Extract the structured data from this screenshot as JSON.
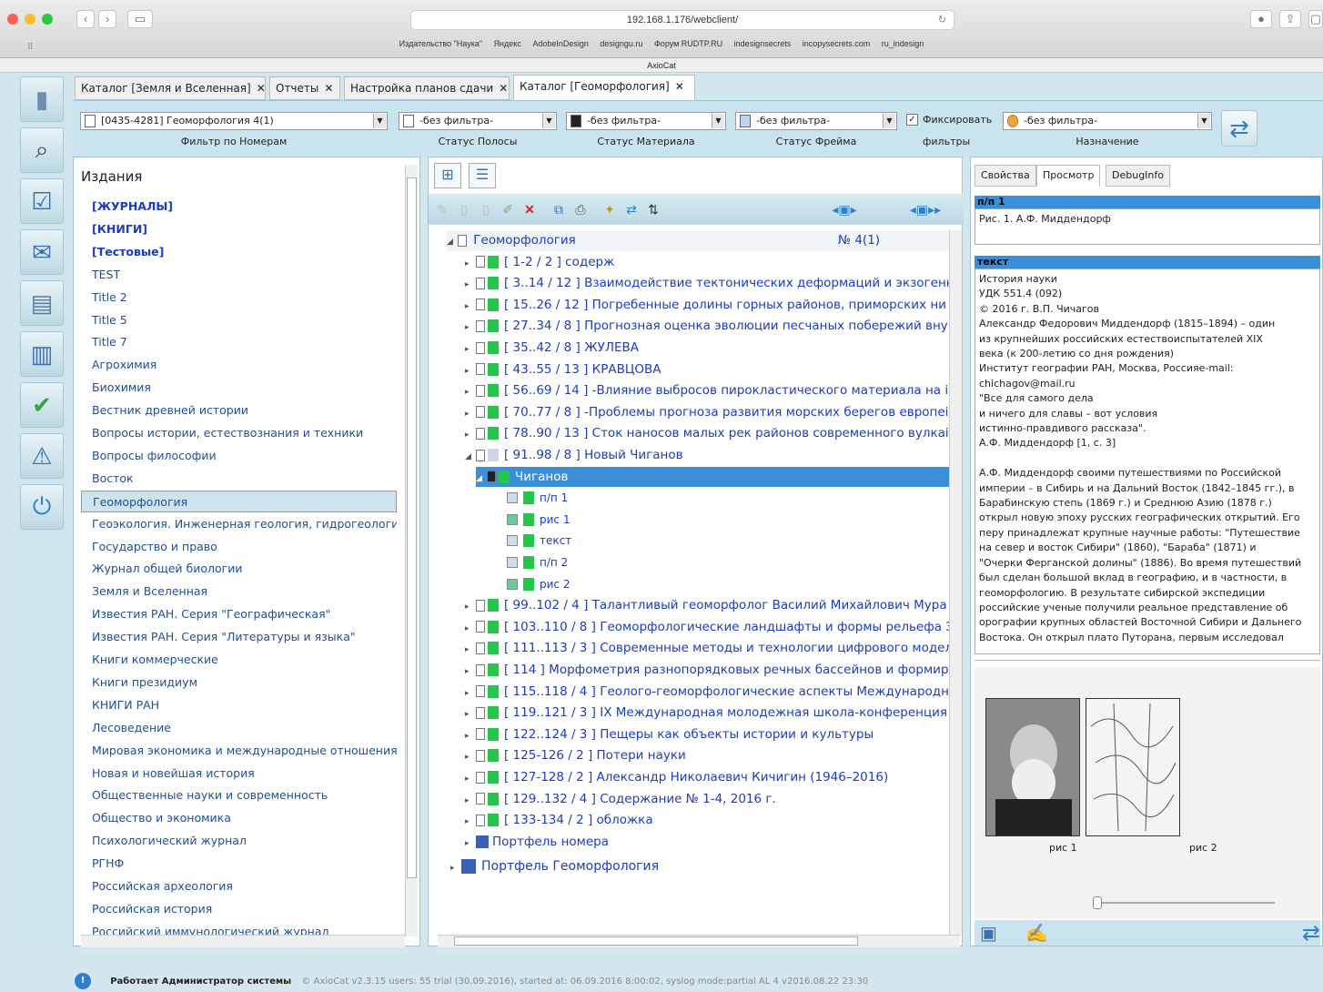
{
  "browser": {
    "url": "192.168.1.176/webclient/",
    "bookmarks": [
      "Издательство \"Наука\"",
      "Яндекс",
      "AdobeInDesign",
      "designgu.ru",
      "Форум RUDTP.RU",
      "indesignsecrets",
      "incopysecrets.com",
      "ru_indesign"
    ],
    "title": "AxioCat"
  },
  "tabs": [
    {
      "label": "Каталог [Земля и Вселенная]"
    },
    {
      "label": "Отчеты"
    },
    {
      "label": "Настройка планов сдачи"
    },
    {
      "label": "Каталог [Геоморфология]"
    }
  ],
  "filters": {
    "number_value": "[0435-4281] Геоморфология 4(1)",
    "number_label": "Фильтр по Номерам",
    "page_status_value": "-без фильтра-",
    "page_status_label": "Статус Полосы",
    "material_status_value": "-без фильтра-",
    "material_status_label": "Статус Материала",
    "frame_status_value": "-без фильтра-",
    "frame_status_label": "Статус Фрейма",
    "fix_label_1": "Фиксировать",
    "fix_label_2": "фильтры",
    "assign_value": "-без фильтра-",
    "assign_label": "Назначение"
  },
  "publications": {
    "header": "Издания",
    "items": [
      {
        "label": "[ЖУРНАЛЫ]"
      },
      {
        "label": "[КНИГИ]"
      },
      {
        "label": "[Тестовые]"
      },
      {
        "label": "TEST"
      },
      {
        "label": "Title 2"
      },
      {
        "label": "Title 5"
      },
      {
        "label": "Title 7"
      },
      {
        "label": "Агрохимия"
      },
      {
        "label": "Биохимия"
      },
      {
        "label": "Вестник древней истории"
      },
      {
        "label": "Вопросы истории, естествознания и техники"
      },
      {
        "label": "Вопросы философии"
      },
      {
        "label": "Восток"
      },
      {
        "label": "Геоморфология"
      },
      {
        "label": "Геоэкология. Инженерная геология, гидрогеология"
      },
      {
        "label": "Государство и право"
      },
      {
        "label": "Журнал общей биологии"
      },
      {
        "label": "Земля и Вселенная"
      },
      {
        "label": "Известия РАН. Серия \"Географическая\""
      },
      {
        "label": "Известия РАН. Серия \"Литературы и языка\""
      },
      {
        "label": "Книги коммерческие"
      },
      {
        "label": "Книги президиум"
      },
      {
        "label": "КНИГИ РАН"
      },
      {
        "label": "Лесоведение"
      },
      {
        "label": "Мировая экономика и международные отношения"
      },
      {
        "label": "Новая и новейшая история"
      },
      {
        "label": "Общественные науки и современность"
      },
      {
        "label": "Общество и экономика"
      },
      {
        "label": "Психологический журнал"
      },
      {
        "label": "РГНФ"
      },
      {
        "label": "Российская археология"
      },
      {
        "label": "Российская история"
      },
      {
        "label": "Российский иммунологический журнал"
      }
    ]
  },
  "tree": {
    "root": "Геоморфология",
    "issue": "№ 4(1)",
    "articles": [
      "[ 1-2 / 2 ] содерж",
      "[ 3..14 / 12 ] Взаимодействие тектонических деформаций и экзогенн",
      "[ 15..26 / 12 ] Погребенные долины горных районов, приморских ни",
      "[ 27..34 / 8 ] Прогнозная оценка эволюции песчаных побережий вну",
      "[ 35..42 / 8 ] ЖУЛЕВА",
      "[ 43..55 / 13 ] КРАВЦОВА",
      "[ 56..69 / 14 ] -Влияние выбросов пирокластического материала на і",
      "[ 70..77 / 8 ] -Проблемы прогноза развития морских берегов европеі",
      "[ 78..90 / 13 ] Сток наносов малых рек районов современного вулкаі",
      "[ 91..98 / 8 ] Новый Чиганов"
    ],
    "selected": "Чиганов",
    "children": [
      "п/п 1",
      "рис 1",
      "текст",
      "п/п 2",
      "рис 2"
    ],
    "articles_after": [
      "[ 99..102 / 4 ] Талантливый геоморфолог Василий Михайлович Мура",
      "[ 103..110 / 8 ] Геоморфологические ландшафты и формы рельефа З",
      "[ 111..113 / 3 ] Современные методы и технологии цифрового модел",
      "[ 114 ] Морфометрия разнопорядковых речных бассейнов и формирс",
      "[ 115..118 / 4 ] Геолого-геоморфологические аспекты Международн",
      "[ 119..121 / 3 ] IX Международная молодежная школа-конференция",
      "[ 122..124 / 3 ] Пещеры как объекты истории и культуры",
      "[ 125-126 / 2 ] Потери науки",
      "[ 127-128 / 2 ] Александр Николаевич Кичигин (1946–2016)",
      "[ 129..132 / 4 ] Содержание № 1-4, 2016 г.",
      "[ 133-134 / 2 ] обложка"
    ],
    "portfolio_issue": "Портфель номера",
    "portfolio_pub": "Портфель Геоморфология"
  },
  "right": {
    "tabs": [
      "Свойства",
      "Просмотр",
      "DebugInfo"
    ],
    "pp1_header": "п/п 1",
    "pp1_text": "Рис. 1. А.Ф. Миддендорф",
    "text_header": "текст",
    "text_lines": [
      "История науки",
      "УДК 551.4 (092)",
      "© 2016 г.   В.П. Чичагов",
      "Александр Федорович Миддендорф (1815–1894) – один",
      "из крупнейших российских естествоиспытателей XIX",
      "века (к 200-летию со дня рождения)",
      "Институт географии РАН, Москва, Россияe-mail:",
      "chichagov@mail.ru",
      "\"Все для самого дела",
      "и ничего для славы – вот условия",
      "истинно-правдивого рассказа\".",
      "А.Ф. Миддендорф [1, с. 3]",
      "",
      "А.Ф. Миддендорф своими путешествиями по Российской",
      "империи – в Сибирь и на Дальний Восток (1842–1845 гг.), в",
      "Барабинскую степь (1869 г.) и Среднюю Азию (1878 г.)",
      "открыл новую эпоху русских географических открытий. Его",
      "перу принадлежат крупные научные работы: \"Путешествие",
      "на север и восток Сибири\" (1860), \"Бараба\" (1871) и",
      "\"Очерки Ферганской долины\" (1886). Во время путешествий",
      "был сделан большой вклад в географию, и в частности, в",
      "геоморфологию. В результате сибирской экспедиции",
      "российские ученые получили реальное представление об",
      "орографии крупных областей Восточной Сибири и Дальнего",
      "Востока. Он открыл плато Путорана, первым исследовал"
    ],
    "img1_caption": "рис 1",
    "img2_caption": "рис 2"
  },
  "status": {
    "main": "Работает Администратор системы",
    "detail": "© AxioCat v2.3.15 users: 55 trial (30.09.2016), started at: 06.09.2016 8:00:02, syslog mode:partial   AL 4 v2016.08.22 23:30"
  }
}
